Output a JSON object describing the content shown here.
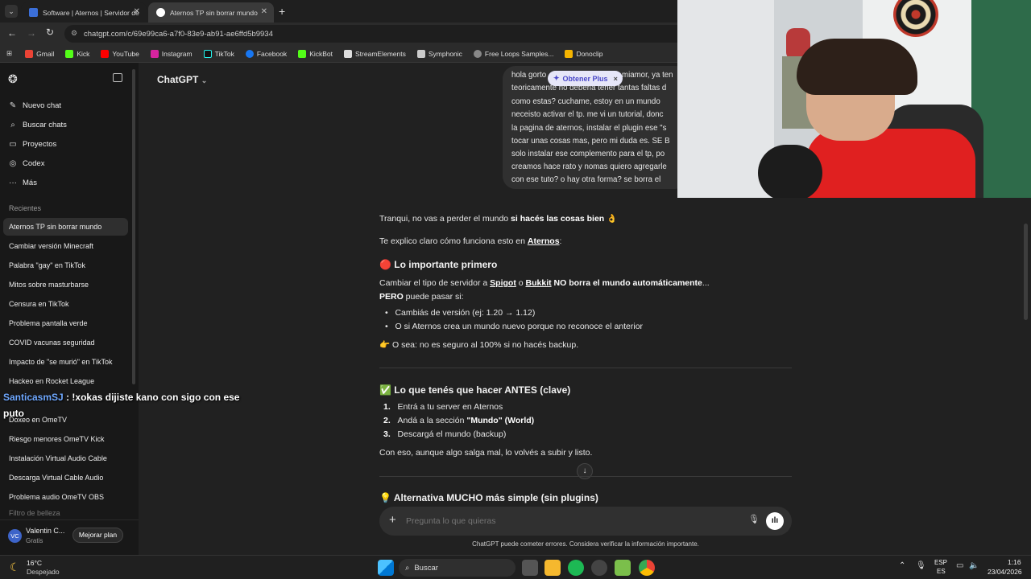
{
  "browser": {
    "tabs": [
      {
        "title": "Software | Aternos | Servidor de"
      },
      {
        "title": "Aternos TP sin borrar mundo"
      }
    ],
    "new_tab": "+",
    "url": "chatgpt.com/c/69e99ca6-a7f0-83e9-ab91-ae6ffd5b9934",
    "bookmarks": [
      "Gmail",
      "Kick",
      "YouTube",
      "Instagram",
      "TikTok",
      "Facebook",
      "KickBot",
      "StreamElements",
      "Symphonic",
      "Free Loops Samples...",
      "Donoclip"
    ]
  },
  "sidebar": {
    "actions": [
      "Nuevo chat",
      "Buscar chats",
      "Proyectos",
      "Codex",
      "Más"
    ],
    "section_label": "Recientes",
    "chats": [
      "Aternos TP sin borrar mundo",
      "Cambiar versión Minecraft",
      "Palabra \"gay\" en TikTok",
      "Mitos sobre masturbarse",
      "Censura en TikTok",
      "Problema pantalla verde",
      "COVID vacunas seguridad",
      "Impacto de \"se murió\" en TikTok",
      "Hackeo en Rocket League",
      "Doxeo en OmeTV",
      "Riesgo menores OmeTV Kick",
      "Instalación Virtual Audio Cable",
      "Descarga Virtual Cable Audio",
      "Problema audio OmeTV OBS",
      "Filtro de belleza"
    ],
    "user_initials": "VC",
    "user_name": "Valentin C...",
    "user_plan": "Gratis",
    "upgrade_button": "Mejorar plan"
  },
  "header": {
    "model": "ChatGPT",
    "plus_button": "Obtener Plus"
  },
  "user_message": [
    "hola gorto",
    "teoricamente no deberia tener tantas faltas d",
    "como estas? cuchame, estoy en  un mundo",
    "neceisto activar el tp. me vi un tutorial, donc",
    "la pagina de aternos, instalar el plugin ese \"s",
    "tocar unas cosas mas, pero mi duda es. SE B",
    "solo instalar ese complemento para el tp, po",
    "creamos hace rato y nomas quiero agregarle",
    "con ese tuto? o hay otra forma? se borra el"
  ],
  "user_message_tail": "miamor, ya ten",
  "assistant": {
    "intro_a": "Tranqui, no vas a perder el mundo ",
    "intro_b": "si hacés las cosas bien",
    "intro_emoji": "👌",
    "explain_a": "Te explico claro cómo funciona esto en ",
    "explain_b": "Aternos",
    "explain_c": ":",
    "h1_emoji": "🔴",
    "h1": "Lo importante primero",
    "p1_a": "Cambiar el tipo de servidor a ",
    "p1_b": "Spigot",
    "p1_c": " o ",
    "p1_d": "Bukkit",
    "p1_e": " NO borra el mundo automáticamente",
    "p1_f": "...",
    "p2_a": "PERO",
    "p2_b": " puede pasar si:",
    "bullets": [
      "Cambiás de versión (ej: 1.20 → 1.12)",
      "O si Aternos crea un mundo nuevo porque no reconoce el anterior"
    ],
    "note_emoji": "👉",
    "note": "O sea: no es seguro al 100% si no hacés backup.",
    "h2_emoji": "✅",
    "h2": "Lo que tenés que hacer ANTES (clave)",
    "steps": [
      {
        "n": "1.",
        "text": "Entrá a tu server en Aternos",
        "bold": ""
      },
      {
        "n": "2.",
        "text": "Andá a la sección ",
        "bold": "\"Mundo\" (World)"
      },
      {
        "n": "3.",
        "text": "Descargá el mundo (backup)",
        "bold": ""
      }
    ],
    "p3": "Con eso, aunque algo salga mal, lo volvés a subir y listo.",
    "h3_emoji": "💡",
    "h3": "Alternativa MUCHO más simple (sin plugins)"
  },
  "composer": {
    "placeholder": "Pregunta lo que quieras",
    "disclaimer": "ChatGPT puede cometer errores. Considera verificar la información importante."
  },
  "stream_overlay": {
    "user": "SanticasmSJ",
    "message": ": !xokas dijiste kano con sigo con ese",
    "message_2": "puto"
  },
  "taskbar": {
    "temperature": "16°C",
    "weather": "Despejado",
    "search": "Buscar",
    "lang": "ESP",
    "lang2": "ES",
    "time": "1:16",
    "date": "23/04/2026"
  },
  "colors": {
    "accent": "#5b5bd6",
    "sidebar": "#181818",
    "main": "#212121"
  }
}
